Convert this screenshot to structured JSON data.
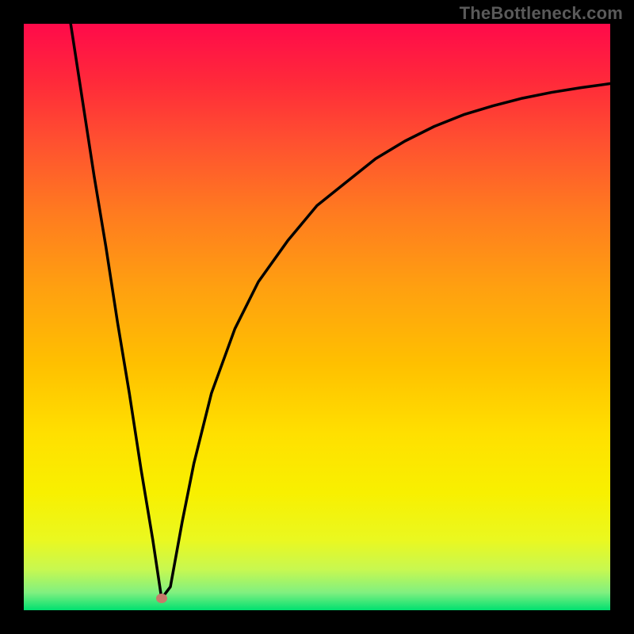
{
  "watermark": "TheBottleneck.com",
  "chart_data": {
    "type": "line",
    "title": "",
    "xlabel": "",
    "ylabel": "",
    "xlim": [
      0,
      100
    ],
    "ylim": [
      0,
      100
    ],
    "series": [
      {
        "name": "bottleneck-curve",
        "x": [
          8,
          10,
          12,
          14,
          16,
          18,
          20,
          22,
          23.5,
          25,
          27,
          29,
          32,
          36,
          40,
          45,
          50,
          55,
          60,
          65,
          70,
          75,
          80,
          85,
          90,
          95,
          100
        ],
        "y": [
          100,
          87,
          74,
          62,
          49,
          37,
          24,
          12,
          2,
          4,
          15,
          25,
          37,
          48,
          56,
          63,
          69,
          73,
          77,
          80,
          82.5,
          84.5,
          86,
          87.3,
          88.3,
          89.1,
          89.8
        ]
      }
    ],
    "marker": {
      "x": 23.5,
      "y": 2,
      "color": "#c77a6a",
      "label": "optimal-point"
    },
    "gradient_stops": [
      {
        "pos": 0,
        "color": "#ff0a4a"
      },
      {
        "pos": 20,
        "color": "#ff5030"
      },
      {
        "pos": 45,
        "color": "#ffa010"
      },
      {
        "pos": 70,
        "color": "#ffe000"
      },
      {
        "pos": 93,
        "color": "#c8f850"
      },
      {
        "pos": 100,
        "color": "#00e070"
      }
    ]
  }
}
